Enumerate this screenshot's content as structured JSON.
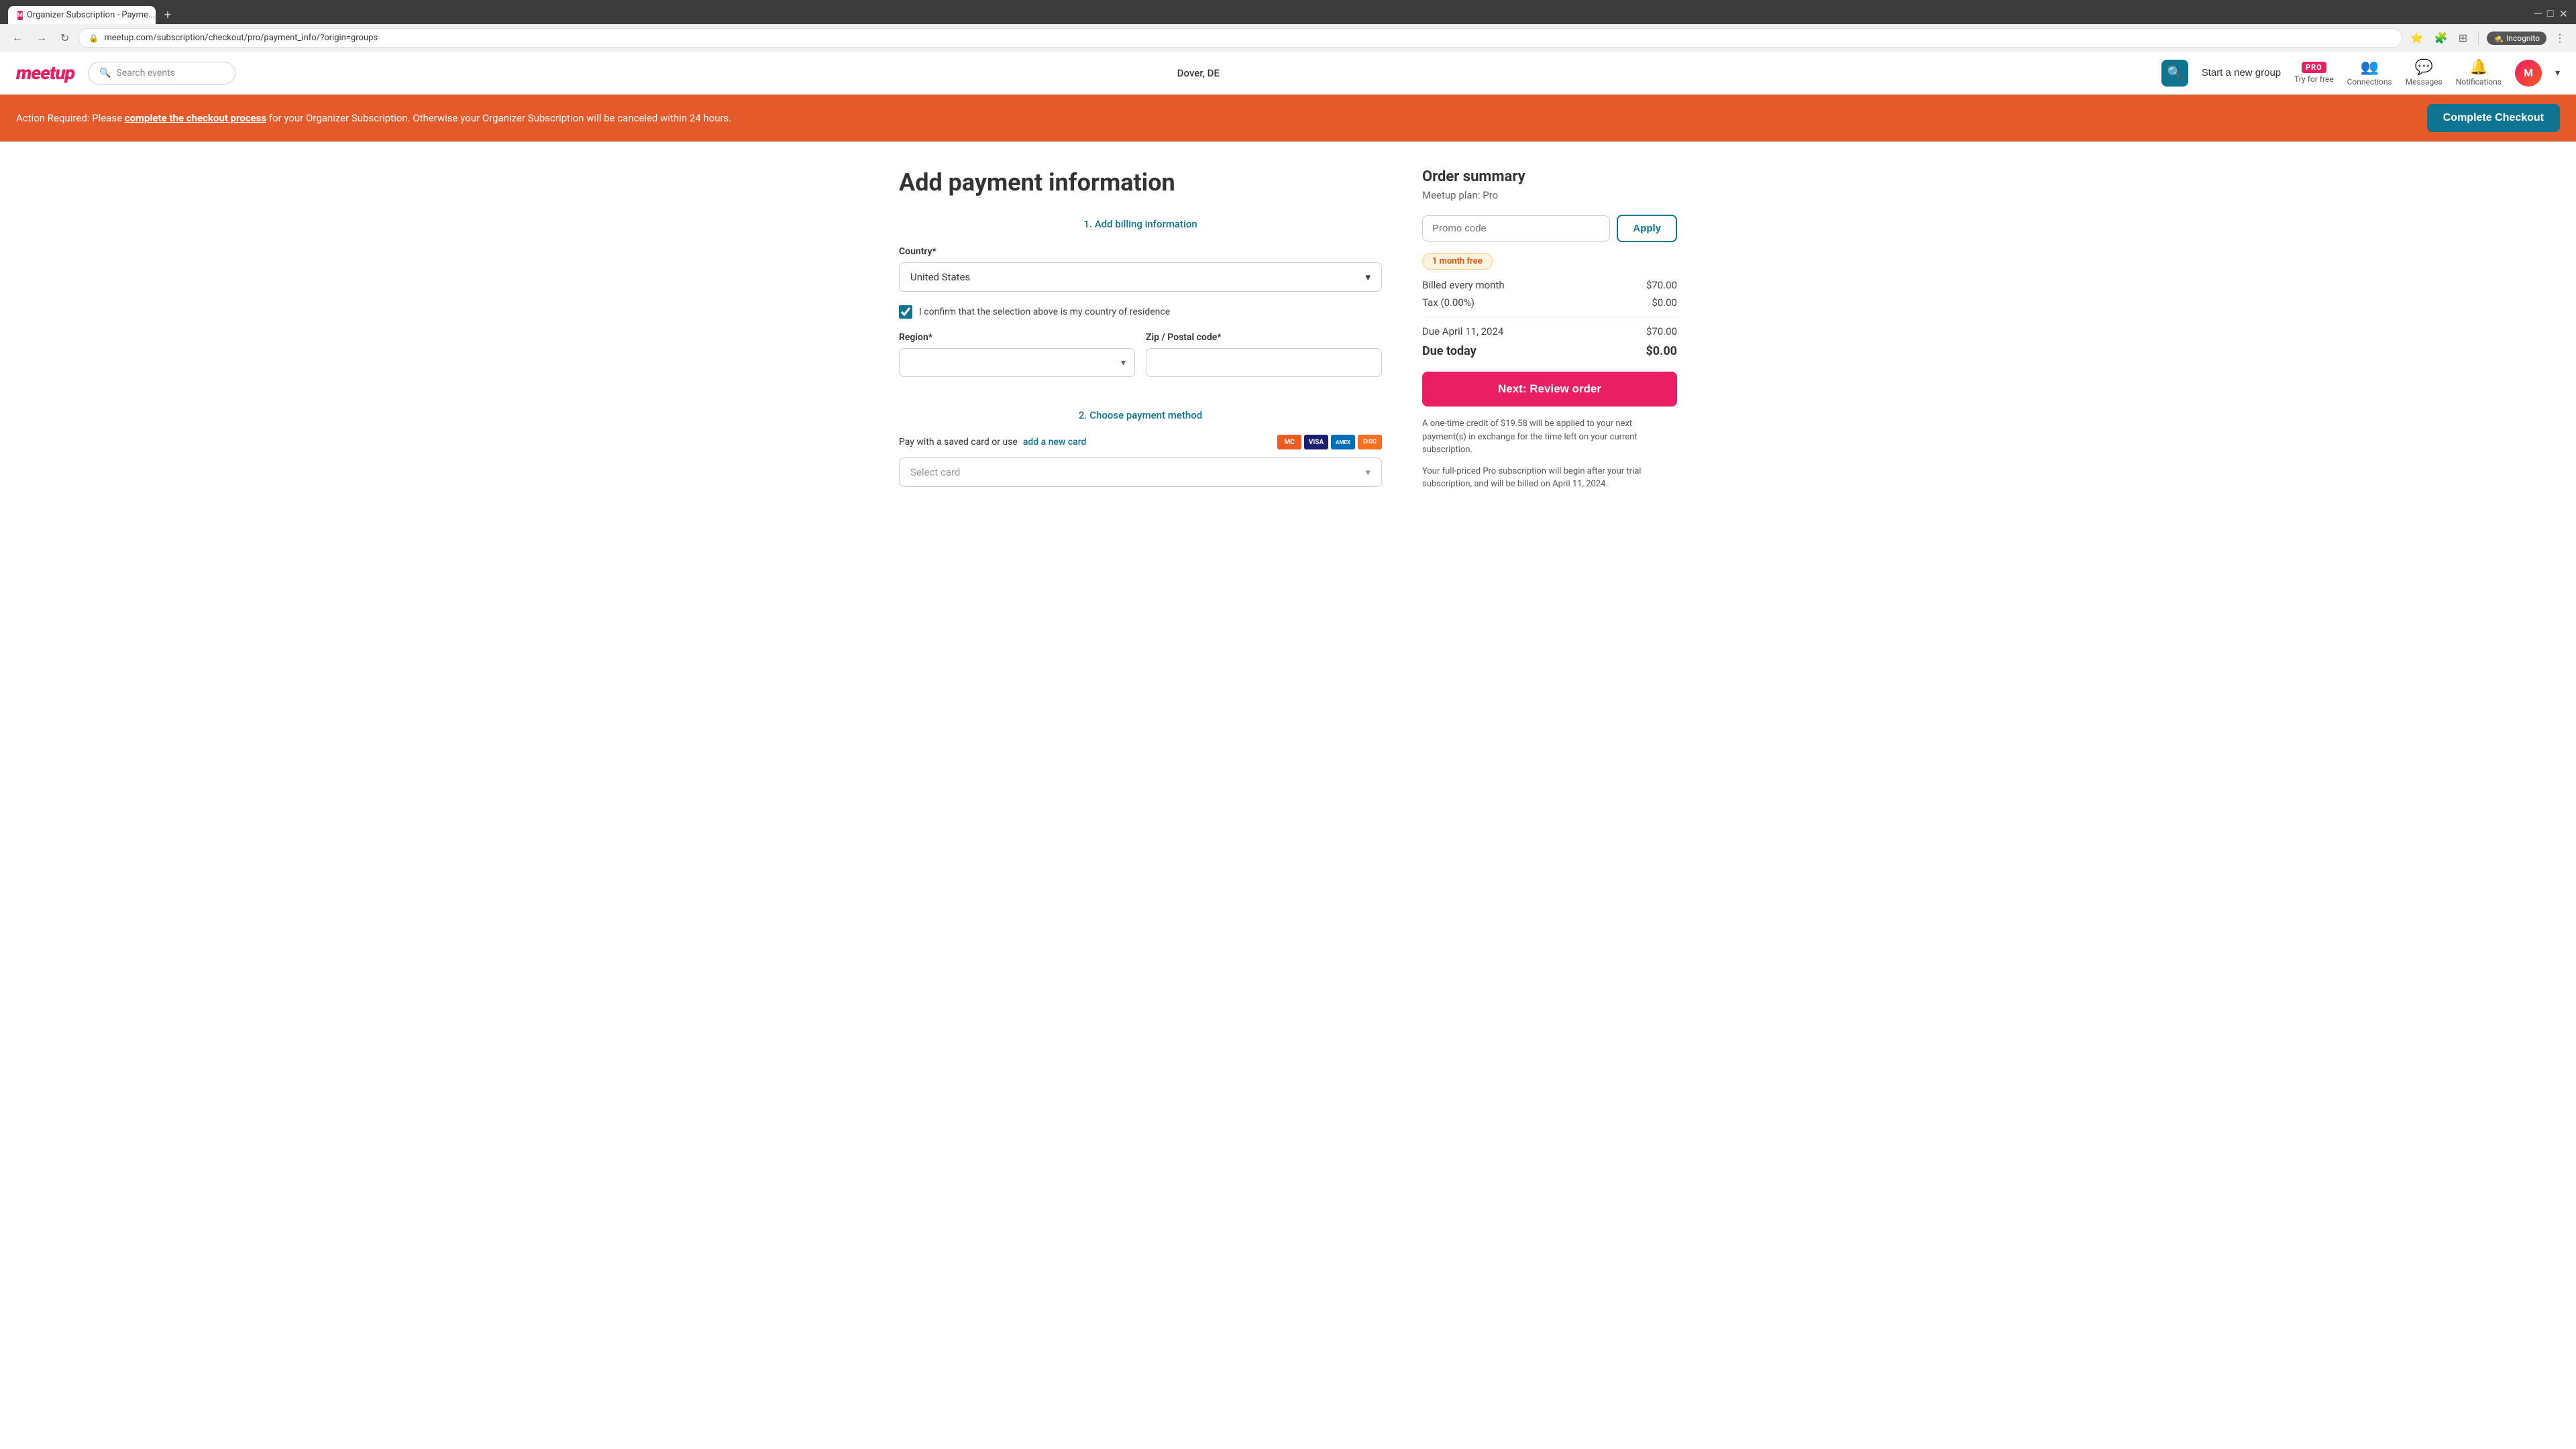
{
  "browser": {
    "tab_favicon": "M",
    "tab_title": "Organizer Subscription - Payme...",
    "tab_new_label": "+",
    "url": "meetup.com/subscription/checkout/pro/payment_info/?origin=groups",
    "nav_back": "←",
    "nav_forward": "→",
    "nav_refresh": "↻",
    "incognito_label": "Incognito",
    "search_icon": "🔍",
    "star_icon": "☆",
    "puzzle_icon": "⊕",
    "layout_icon": "⊞",
    "more_icon": "⋮"
  },
  "header": {
    "logo": "meetup",
    "search_placeholder": "Search events",
    "location": "Dover, DE",
    "start_group": "Start a new group",
    "pro_badge": "PRO",
    "pro_label": "Try for free",
    "connections_label": "Connections",
    "messages_label": "Messages",
    "notifications_label": "Notifications",
    "search_btn_icon": "🔍",
    "chevron_icon": "▾"
  },
  "alert": {
    "text_before": "Action Required: Please ",
    "link_text": "complete the checkout process",
    "text_after": " for your Organizer Subscription. Otherwise your Organizer Subscription will be canceled within 24 hours.",
    "cta_label": "Complete Checkout"
  },
  "form": {
    "page_title": "Add payment information",
    "step1_label": "1. Add billing information",
    "country_label": "Country*",
    "country_value": "United States",
    "country_placeholder": "United States",
    "checkbox_checked": true,
    "checkbox_label": "I confirm that the selection above is my country of residence",
    "region_label": "Region*",
    "zip_label": "Zip / Postal code*",
    "step2_label": "2. Choose payment method",
    "payment_text": "Pay with a saved card or use ",
    "payment_link": "add a new card",
    "select_card_placeholder": "Select card",
    "card_icons": {
      "mastercard": "MC",
      "visa": "VISA",
      "amex": "AMEX",
      "discover": "DISC"
    }
  },
  "order_summary": {
    "title": "Order summary",
    "plan_label": "Meetup plan: Pro",
    "promo_placeholder": "Promo code",
    "apply_label": "Apply",
    "free_badge": "1 month free",
    "billed_label": "Billed every month",
    "billed_amount": "$70.00",
    "tax_label": "Tax (0.00%)",
    "tax_amount": "$0.00",
    "due_date_label": "Due April 11, 2024",
    "due_date_amount": "$70.00",
    "due_today_label": "Due today",
    "due_today_amount": "$0.00",
    "next_btn_label": "Next: Review order",
    "credit_note": "A one-time credit of $19.58 will be applied to your next payment(s) in exchange for the time left on your current subscription.",
    "trial_note": "Your full-priced Pro subscription will begin after your trial subscription, and will be billed on April 11, 2024."
  }
}
